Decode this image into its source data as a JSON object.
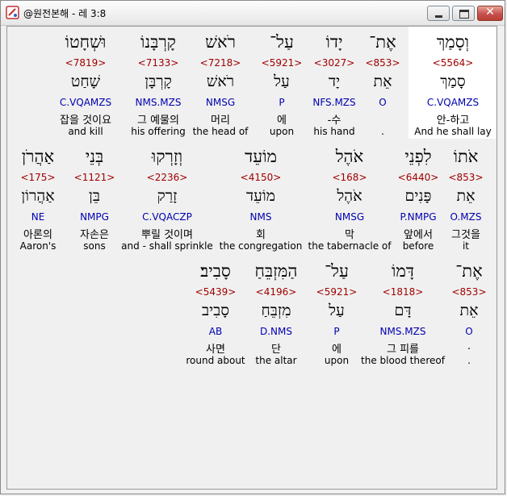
{
  "window": {
    "title": "@원전본해 - 레 3:8"
  },
  "rows": [
    [
      {
        "heb": "וְסָמַךְ",
        "num": "<5564>",
        "lemma": "סָמַךְ",
        "parse": "C.VQAMZS",
        "kor": "안-하고",
        "eng": "And he shall lay",
        "selected": true
      },
      {
        "heb": "אֶת־",
        "num": "<853>",
        "lemma": "אֵת",
        "parse": "O",
        "kor": "",
        "eng": "."
      },
      {
        "heb": "יָדוֹ",
        "num": "<3027>",
        "lemma": "יָד",
        "parse": "NFS.MZS",
        "kor": "-수",
        "eng": "his hand"
      },
      {
        "heb": "עַל־",
        "num": "<5921>",
        "lemma": "עַל",
        "parse": "P",
        "kor": "에",
        "eng": "upon"
      },
      {
        "heb": "רֹאשׁ",
        "num": "<7218>",
        "lemma": "רֹאשׁ",
        "parse": "NMSG",
        "kor": "머리",
        "eng": "the head of"
      },
      {
        "heb": "קָרְבָּנוֹ",
        "num": "<7133>",
        "lemma": "קָרְבָּן",
        "parse": "NMS.MZS",
        "kor": "그 예물의",
        "eng": "his offering"
      },
      {
        "heb": "וּשְׁחָטוֹ",
        "num": "<7819>",
        "lemma": "שָׁחַט",
        "parse": "C.VQAMZS",
        "kor": "잡을 것이요",
        "eng": "and kill"
      }
    ],
    [
      {
        "heb": "אֹתוֹ",
        "num": "<853>",
        "lemma": "אֵת",
        "parse": "O.MZS",
        "kor": "그것을",
        "eng": "it"
      },
      {
        "heb": "לִפְנֵי",
        "num": "<6440>",
        "lemma": "פָּנִים",
        "parse": "P.NMPG",
        "kor": "앞에서",
        "eng": "before"
      },
      {
        "heb": "אֹהֶל",
        "num": "<168>",
        "lemma": "אֹהֶל",
        "parse": "NMSG",
        "kor": "막",
        "eng": "the tabernacle of"
      },
      {
        "heb": "מוֹעֵד",
        "num": "<4150>",
        "lemma": "מוֹעֵד",
        "parse": "NMS",
        "kor": "회",
        "eng": "the congregation"
      },
      {
        "heb": "וְזָרְקוּ",
        "num": "<2236>",
        "lemma": "זָרַק",
        "parse": "C.VQACZP",
        "kor": "뿌릴 것이며",
        "eng": "and - shall sprinkle"
      },
      {
        "heb": "בְּנֵי",
        "num": "<1121>",
        "lemma": "בֵּן",
        "parse": "NMPG",
        "kor": "자손은",
        "eng": "sons"
      },
      {
        "heb": "אַהֲרֹן",
        "num": "<175>",
        "lemma": "אַהֲרוֹן",
        "parse": "NE",
        "kor": "아론의",
        "eng": "Aaron's"
      }
    ],
    [
      {
        "heb": "אֶת־",
        "num": "<853>",
        "lemma": "אֵת",
        "parse": "O",
        "kor": ".",
        "eng": "."
      },
      {
        "heb": "דָּמוֹ",
        "num": "<1818>",
        "lemma": "דָּם",
        "parse": "NMS.MZS",
        "kor": "그 피를",
        "eng": "the blood thereof"
      },
      {
        "heb": "עַל־",
        "num": "<5921>",
        "lemma": "עַל",
        "parse": "P",
        "kor": "에",
        "eng": "upon"
      },
      {
        "heb": "הַמִּזְבֵּחַ",
        "num": "<4196>",
        "lemma": "מִזְבֵּחַ",
        "parse": "D.NMS",
        "kor": "단",
        "eng": "the altar"
      },
      {
        "heb": "סָבִיב׃",
        "num": "<5439>",
        "lemma": "סָבִיב",
        "parse": "AB",
        "kor": "사면",
        "eng": "round about"
      }
    ]
  ]
}
